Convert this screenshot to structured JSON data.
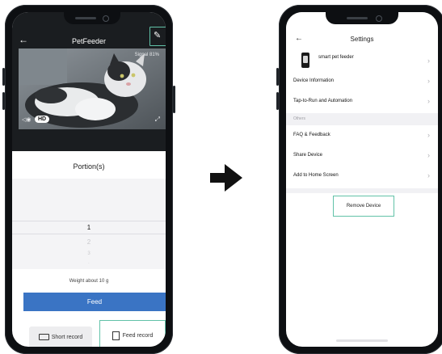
{
  "phone_left": {
    "title": "PetFeeder",
    "signal": "Signal  81%",
    "quality": "HD",
    "portion_label": "Portion(s)",
    "picker_values": [
      "1",
      "2",
      "3",
      "."
    ],
    "weight": "Weight  about 10 g",
    "feed_label": "Feed",
    "short_record_label": "Short record",
    "feed_record_label": "Feed record"
  },
  "phone_right": {
    "title": "Settings",
    "device_name": "smart pet feeder",
    "items": [
      {
        "label": "Device Information"
      },
      {
        "label": "Tap-to-Run and Automation"
      },
      {
        "label": "FAQ & Feedback"
      },
      {
        "label": "Share Device"
      },
      {
        "label": "Add to Home Screen"
      }
    ],
    "section_others": "Others",
    "remove_label": "Remove Device"
  },
  "icons": {
    "back": "back-arrow-icon",
    "edit": "edit-pencil-icon",
    "chevron": "chevron-right-icon",
    "arrow": "right-arrow-icon"
  },
  "colors": {
    "highlight": "#61c2a8",
    "primary": "#3a74c4",
    "phone_body": "#0d0f12"
  }
}
